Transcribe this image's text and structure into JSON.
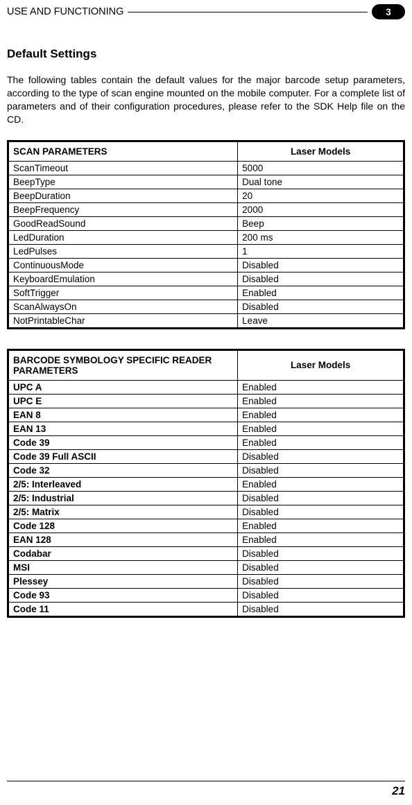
{
  "header": {
    "running_title": "USE AND FUNCTIONING",
    "chapter_badge": "3"
  },
  "section_title": "Default Settings",
  "intro_paragraph": "The following tables contain the default values for the major barcode setup parameters, according to the type of scan engine mounted on the mobile computer. For a complete list of parameters and of their configuration procedures, please refer to the SDK Help file on the CD.",
  "table1": {
    "header_left": "SCAN PARAMETERS",
    "header_right": "Laser Models",
    "rows": [
      {
        "name": "ScanTimeout",
        "value": "5000"
      },
      {
        "name": "BeepType",
        "value": "Dual tone"
      },
      {
        "name": "BeepDuration",
        "value": "20"
      },
      {
        "name": "BeepFrequency",
        "value": "2000"
      },
      {
        "name": "GoodReadSound",
        "value": "Beep"
      },
      {
        "name": "LedDuration",
        "value": "200 ms"
      },
      {
        "name": "LedPulses",
        "value": "1"
      },
      {
        "name": "ContinuousMode",
        "value": "Disabled"
      },
      {
        "name": "KeyboardEmulation",
        "value": "Disabled"
      },
      {
        "name": "SoftTrigger",
        "value": "Enabled"
      },
      {
        "name": "ScanAlwaysOn",
        "value": "Disabled"
      },
      {
        "name": "NotPrintableChar",
        "value": "Leave"
      }
    ]
  },
  "table2": {
    "header_left": "BARCODE SYMBOLOGY SPECIFIC READER PARAMETERS",
    "header_right": "Laser Models",
    "rows": [
      {
        "name": "UPC A",
        "value": "Enabled"
      },
      {
        "name": "UPC E",
        "value": "Enabled"
      },
      {
        "name": "EAN 8",
        "value": "Enabled"
      },
      {
        "name": "EAN 13",
        "value": "Enabled"
      },
      {
        "name": "Code 39",
        "value": "Enabled"
      },
      {
        "name": "Code 39 Full ASCII",
        "value": "Disabled"
      },
      {
        "name": "Code 32",
        "value": "Disabled"
      },
      {
        "name": "2/5: Interleaved",
        "value": "Enabled"
      },
      {
        "name": "2/5: Industrial",
        "value": "Disabled"
      },
      {
        "name": "2/5: Matrix",
        "value": "Disabled"
      },
      {
        "name": "Code 128",
        "value": "Enabled"
      },
      {
        "name": "EAN 128",
        "value": "Enabled"
      },
      {
        "name": "Codabar",
        "value": "Disabled"
      },
      {
        "name": "MSI",
        "value": "Disabled"
      },
      {
        "name": "Plessey",
        "value": "Disabled"
      },
      {
        "name": "Code 93",
        "value": "Disabled"
      },
      {
        "name": "Code 11",
        "value": "Disabled"
      }
    ]
  },
  "footer": {
    "page_number": "21"
  }
}
